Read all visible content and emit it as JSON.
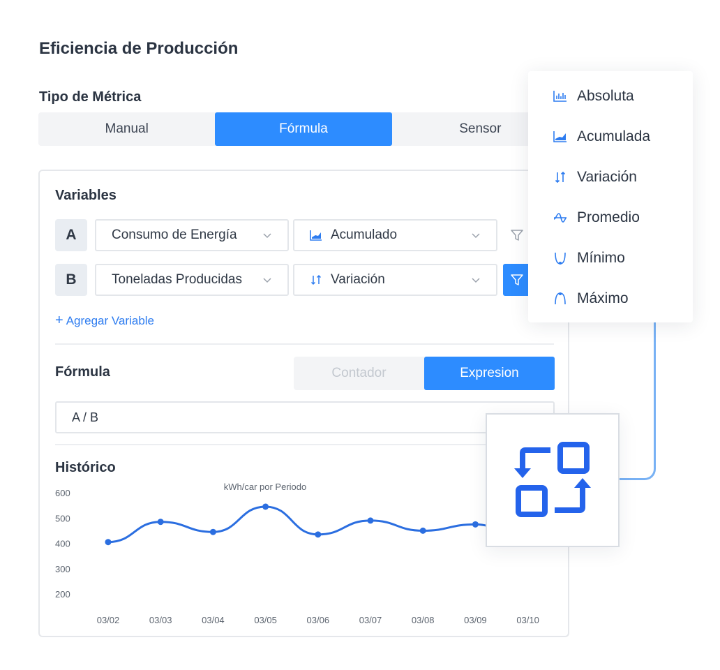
{
  "page": {
    "title": "Eficiencia de Producción"
  },
  "metric_type": {
    "label": "Tipo de Métrica",
    "tabs": [
      {
        "label": "Manual",
        "active": false
      },
      {
        "label": "Fórmula",
        "active": true
      },
      {
        "label": "Sensor",
        "active": false
      }
    ]
  },
  "variables": {
    "heading": "Variables",
    "rows": [
      {
        "letter": "A",
        "source": "Consumo de Energía",
        "aggregation": "Acumulado",
        "aggregation_icon": "area-chart-icon",
        "filter_active": false
      },
      {
        "letter": "B",
        "source": "Toneladas Producidas",
        "aggregation": "Variación",
        "aggregation_icon": "up-down-arrows-icon",
        "filter_active": true
      }
    ],
    "add_label": "Agregar Variable"
  },
  "formula": {
    "heading": "Fórmula",
    "modes": [
      {
        "label": "Contador",
        "active": false
      },
      {
        "label": "Expresion",
        "active": true
      }
    ],
    "expression": "A / B"
  },
  "history": {
    "heading": "Histórico",
    "chart_data": {
      "type": "line",
      "title": "kWh/car por Periodo",
      "categories": [
        "03/02",
        "03/03",
        "03/04",
        "03/05",
        "03/06",
        "03/07",
        "03/08",
        "03/09",
        "03/10"
      ],
      "values": [
        405,
        485,
        445,
        545,
        435,
        490,
        450,
        475,
        null
      ],
      "y_ticks": [
        "600",
        "500",
        "400",
        "300",
        "200"
      ],
      "ylim": [
        200,
        600
      ],
      "grid": false,
      "color": "#2b6ee0"
    }
  },
  "aggregation_menu": {
    "items": [
      {
        "label": "Absoluta",
        "icon": "bar-chart-icon"
      },
      {
        "label": "Acumulada",
        "icon": "area-chart-icon"
      },
      {
        "label": "Variación",
        "icon": "up-down-arrows-icon"
      },
      {
        "label": "Promedio",
        "icon": "wave-icon"
      },
      {
        "label": "Mínimo",
        "icon": "min-curve-icon"
      },
      {
        "label": "Máximo",
        "icon": "max-curve-icon"
      }
    ]
  },
  "colors": {
    "accent": "#2d8cff",
    "icon_blue": "#2d7cf0",
    "connector": "#78b1f4"
  }
}
